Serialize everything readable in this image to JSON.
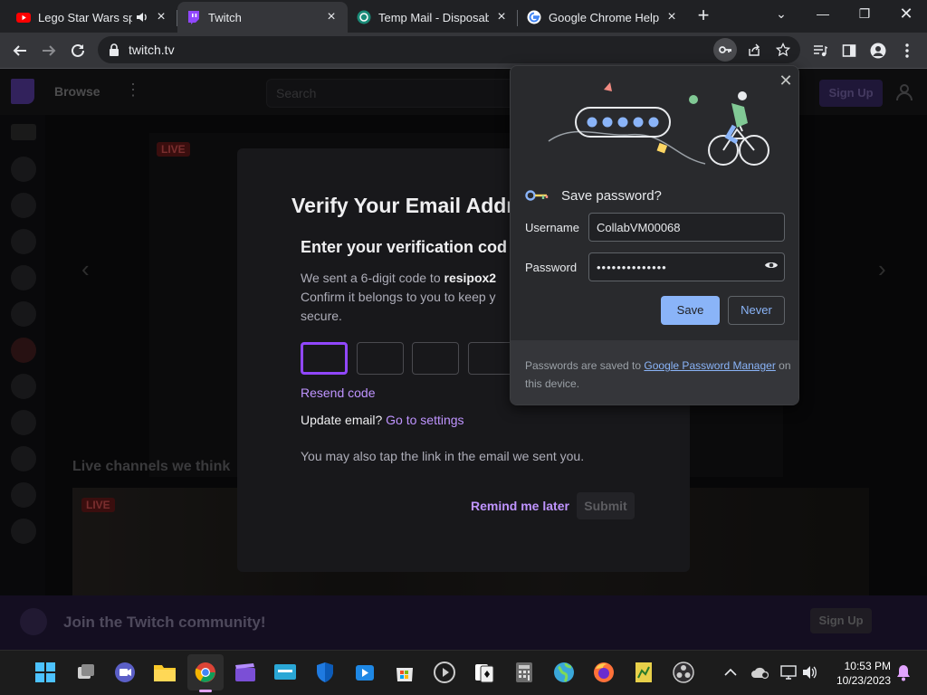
{
  "tabs": [
    {
      "label": "Lego Star Wars sp",
      "icon": "youtube-icon",
      "audio": true
    },
    {
      "label": "Twitch",
      "icon": "twitch-icon",
      "active": true
    },
    {
      "label": "Temp Mail - Disposab",
      "icon": "tempmail-icon"
    },
    {
      "label": "Google Chrome Help",
      "icon": "google-icon"
    }
  ],
  "address": {
    "url": "twitch.tv"
  },
  "twitch": {
    "browse": "Browse",
    "search_placeholder": "Search",
    "signup": "Sign Up",
    "live_badge": "LIVE",
    "channels_title": "Live channels we think",
    "join_text": "Join the Twitch community!",
    "join_signup": "Sign Up"
  },
  "verify": {
    "title": "Verify Your Email Addr",
    "subtitle": "Enter your verification cod",
    "line1_prefix": "We sent a 6-digit code to ",
    "line1_email": "resipox2",
    "line2": "Confirm it belongs to you to keep y",
    "line3": "secure.",
    "resend": "Resend code",
    "update_prefix": "Update email? ",
    "update_link": "Go to settings",
    "tap_note": "You may also tap the link in the email we sent you.",
    "remind": "Remind me later",
    "submit": "Submit"
  },
  "save_password": {
    "title": "Save password?",
    "username_label": "Username",
    "username_value": "CollabVM00068",
    "password_label": "Password",
    "password_value": "••••••••••••••",
    "save": "Save",
    "never": "Never",
    "footer_prefix": "Passwords are saved to ",
    "footer_link": "Google Password Manager",
    "footer_suffix": " on this device."
  },
  "taskbar": {
    "time": "10:53 PM",
    "date": "10/23/2023"
  },
  "colors": {
    "twitch_purple": "#9147ff",
    "chrome_blue": "#8ab4f8",
    "twitch_link": "#bf94ff"
  }
}
